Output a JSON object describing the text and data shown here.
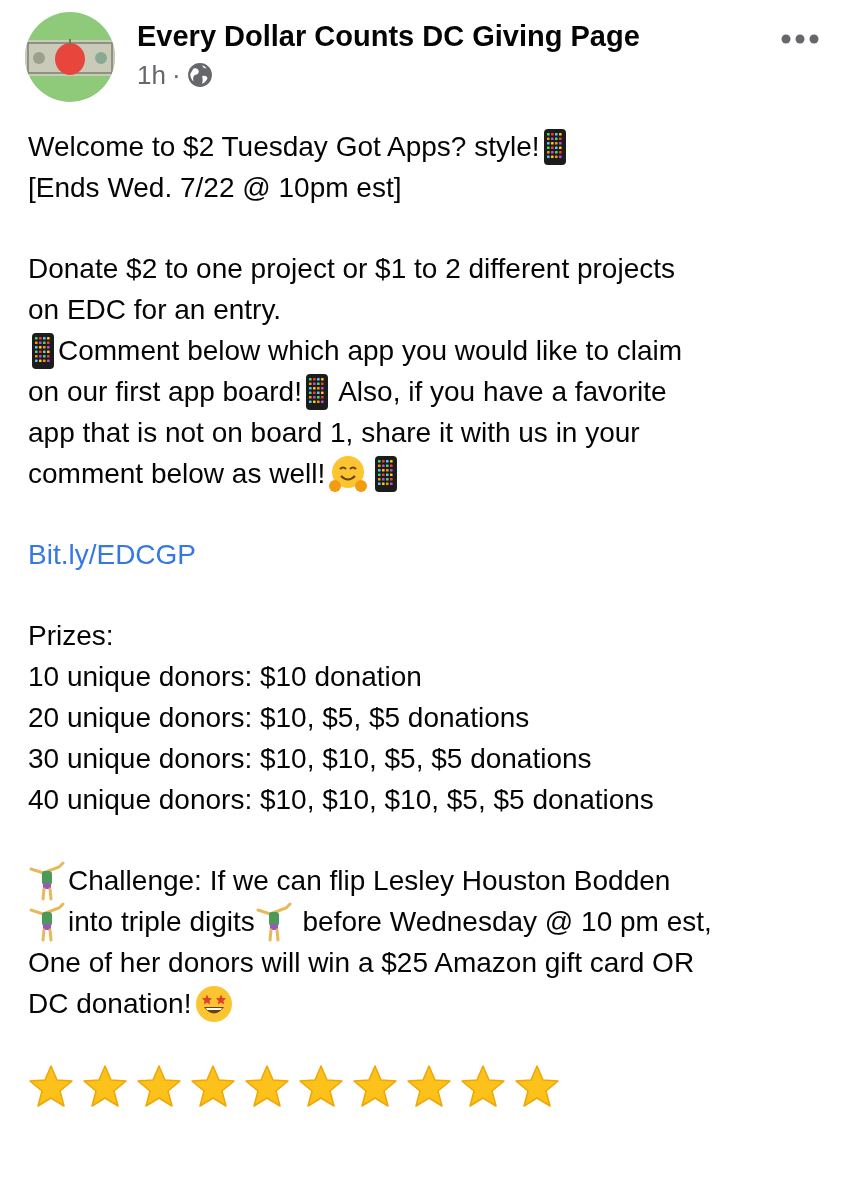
{
  "post": {
    "page_name": "Every Dollar Counts DC Giving Page",
    "time": "1h",
    "separator": "·"
  },
  "paragraphs": [
    {
      "lines": [
        [
          {
            "kind": "text",
            "text": "Welcome to $2 Tuesday Got Apps? style!"
          },
          {
            "kind": "phone"
          }
        ],
        [
          {
            "kind": "text",
            "text": "[Ends Wed. 7/22 @ 10pm est]"
          }
        ]
      ]
    },
    {
      "lines": [
        [
          {
            "kind": "text",
            "text": "Donate $2 to one project or $1 to 2 different projects"
          }
        ],
        [
          {
            "kind": "text",
            "text": "on EDC for an entry."
          }
        ],
        [
          {
            "kind": "phone"
          },
          {
            "kind": "text",
            "text": "Comment below which app you would like to claim"
          }
        ],
        [
          {
            "kind": "text",
            "text": "on our first app board!"
          },
          {
            "kind": "phone"
          },
          {
            "kind": "text",
            "text": " Also, if you have a favorite"
          }
        ],
        [
          {
            "kind": "text",
            "text": "app that is not on board 1, share it with us in your"
          }
        ],
        [
          {
            "kind": "text",
            "text": "comment below as well!"
          },
          {
            "kind": "hug"
          },
          {
            "kind": "phone"
          }
        ]
      ]
    },
    {
      "lines": [
        [
          {
            "kind": "link",
            "text": "Bit.ly/EDCGP"
          }
        ]
      ]
    },
    {
      "lines": [
        [
          {
            "kind": "text",
            "text": "Prizes:"
          }
        ],
        [
          {
            "kind": "text",
            "text": "10 unique donors: $10 donation"
          }
        ],
        [
          {
            "kind": "text",
            "text": "20 unique donors: $10, $5, $5 donations"
          }
        ],
        [
          {
            "kind": "text",
            "text": "30 unique donors: $10, $10, $5, $5 donations"
          }
        ],
        [
          {
            "kind": "text",
            "text": "40 unique donors: $10, $10, $10, $5, $5 donations"
          }
        ]
      ]
    },
    {
      "lines": [
        [
          {
            "kind": "gymnast"
          },
          {
            "kind": "text",
            "text": "Challenge: If we can flip Lesley Houston Bodden"
          }
        ],
        [
          {
            "kind": "gymnast"
          },
          {
            "kind": "text",
            "text": "into triple digits"
          },
          {
            "kind": "gymnast"
          },
          {
            "kind": "text",
            "text": " before Wednesday @ 10 pm est,"
          }
        ],
        [
          {
            "kind": "text",
            "text": "One of her donors will win a $25 Amazon gift card OR"
          }
        ],
        [
          {
            "kind": "text",
            "text": "DC donation!"
          },
          {
            "kind": "starstruck"
          }
        ]
      ]
    },
    {
      "lines": [
        [
          {
            "kind": "star"
          },
          {
            "kind": "star"
          },
          {
            "kind": "star"
          },
          {
            "kind": "star"
          },
          {
            "kind": "star"
          },
          {
            "kind": "star"
          },
          {
            "kind": "star"
          },
          {
            "kind": "star"
          },
          {
            "kind": "star"
          },
          {
            "kind": "star"
          }
        ]
      ]
    }
  ]
}
